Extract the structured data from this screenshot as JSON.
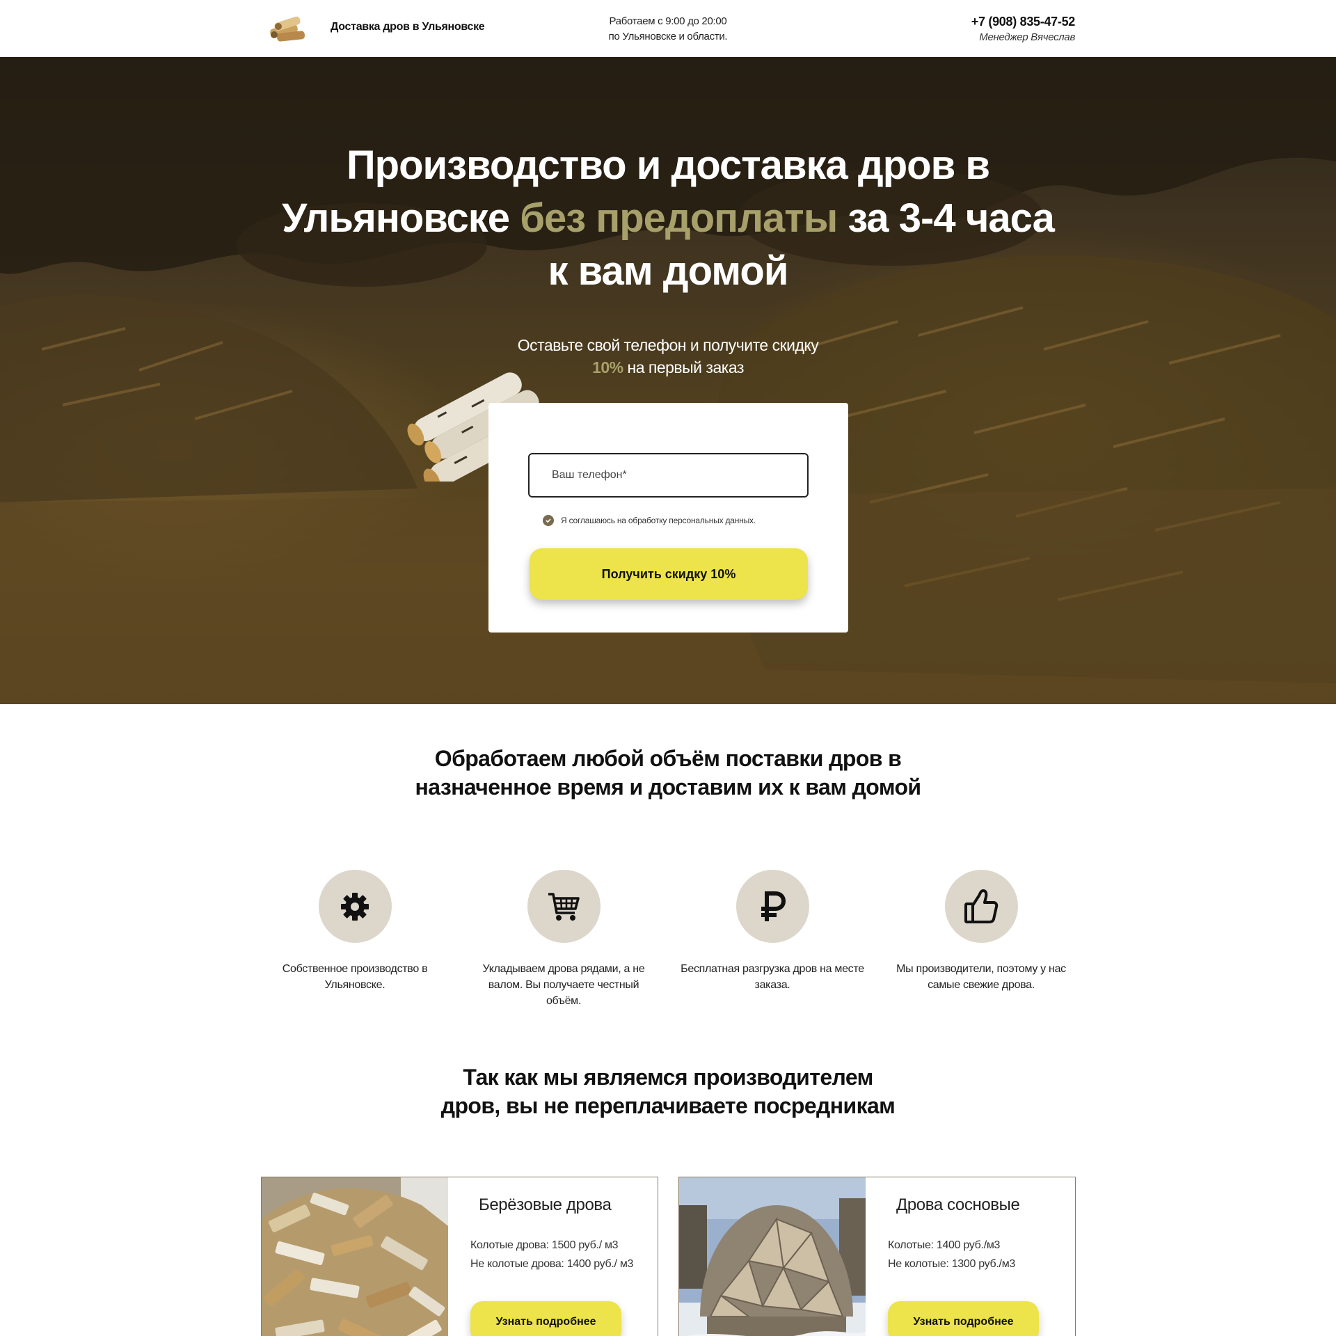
{
  "header": {
    "site_title": "Доставка дров в Ульяновске",
    "hours_line1": "Работаем с 9:00 до 20:00",
    "hours_line2": "по Ульяновске и области.",
    "phone": "+7 (908) 835-47-52",
    "manager": "Менеджер Вячеслав"
  },
  "hero": {
    "title_line1": "Производство и доставка дров в",
    "title_line2_start": "Ульяновске ",
    "title_line2_accent": "без предоплаты",
    "title_line2_end": " за 3-4 часа",
    "title_line3": "к вам домой",
    "subtitle_line1": "Оставьте свой телефон и получите скидку",
    "subtitle_accent": "10%",
    "subtitle_line2_end": " на первый заказ",
    "accent_color": "#a8a06a"
  },
  "form": {
    "phone_placeholder": "Ваш телефон*",
    "phone_value": "",
    "consent_text": "Я соглашаюсь на обработку персональных данных.",
    "consent_checked": true,
    "submit_label": "Получить скидку 10%",
    "button_color": "#ede34a"
  },
  "features": {
    "title_line1": "Обработаем любой объём поставки дров в",
    "title_line2": "назначенное время и доставим их к вам домой",
    "items": [
      {
        "icon": "gear-icon",
        "line1": "Собственное производство в",
        "line2": "Ульяновске."
      },
      {
        "icon": "cart-icon",
        "line1": "Укладываем дрова рядами, а не",
        "line2": "валом. Вы получаете честный объём."
      },
      {
        "icon": "ruble-icon",
        "line1": "Бесплатная разгрузка дров на месте",
        "line2": "заказа."
      },
      {
        "icon": "thumbs-up-icon",
        "line1": "Мы производители, поэтому у нас",
        "line2": "самые свежие дрова."
      }
    ]
  },
  "section2": {
    "title_line1": "Так как мы являемся производителем",
    "title_line2": "дров, вы не переплачиваете посредникам"
  },
  "products": [
    {
      "name": "Берёзовые дрова",
      "price1": "Колотые дрова: 1500 руб./ м3",
      "price2": "Не колотые дрова: 1400 руб./ м3",
      "button": "Узнать подробнее"
    },
    {
      "name": "Дрова сосновые",
      "price1": "Колотые: 1400 руб./м3",
      "price2": "Не колотые: 1300 руб./м3",
      "button": "Узнать подробнее"
    }
  ]
}
